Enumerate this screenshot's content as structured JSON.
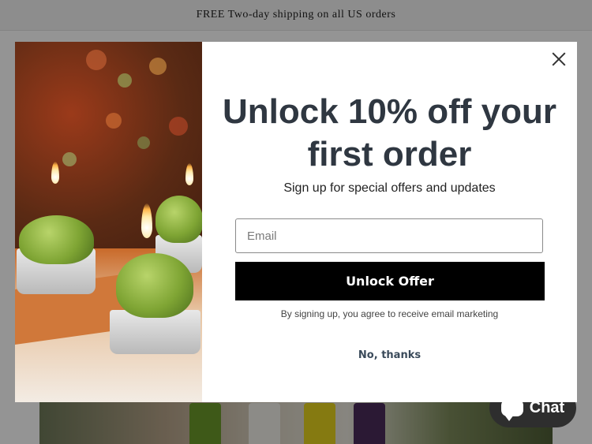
{
  "announcement": {
    "text": "FREE Two-day shipping on all US orders"
  },
  "modal": {
    "headline": "Unlock 10% off your first order",
    "subheadline": "Sign up for special offers and updates",
    "email_placeholder": "Email",
    "email_value": "",
    "cta_label": "Unlock Offer",
    "legal_text": "By signing up, you agree to receive email marketing",
    "dismiss_label": "No, thanks",
    "close_icon": "close-icon",
    "image_icon": "cactus-candles-photo"
  },
  "chat": {
    "label": "Chat",
    "icon": "chat-bubble-icon"
  },
  "colors": {
    "cta_bg": "#000000",
    "overlay": "rgba(0,0,0,0.42)",
    "headline": "#2f3741"
  }
}
